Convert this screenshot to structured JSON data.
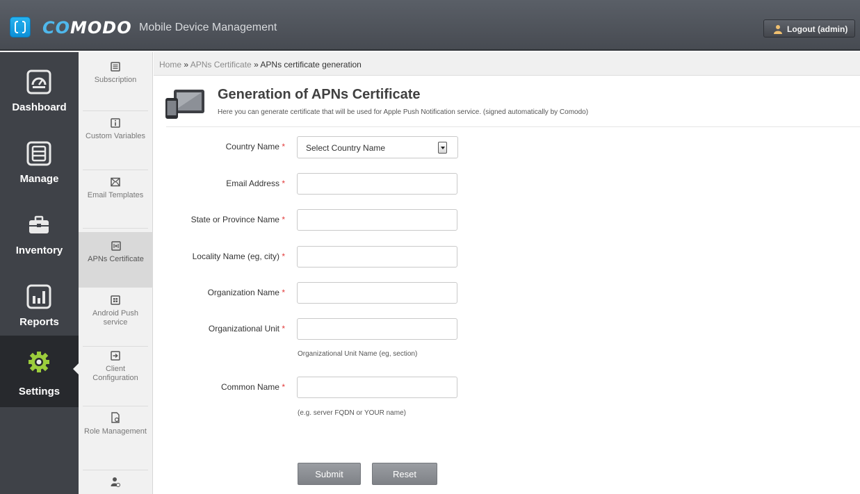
{
  "header": {
    "brand_prefix": "CO",
    "brand_rest": "MODO",
    "subtitle": "Mobile Device Management",
    "logout_label": "Logout (admin)"
  },
  "mainnav": {
    "items": [
      {
        "label": "Dashboard",
        "icon": "dashboard-icon"
      },
      {
        "label": "Manage",
        "icon": "manage-icon"
      },
      {
        "label": "Inventory",
        "icon": "inventory-icon"
      },
      {
        "label": "Reports",
        "icon": "reports-icon"
      },
      {
        "label": "Settings",
        "icon": "settings-gear-icon",
        "active": true
      }
    ]
  },
  "subnav": {
    "items": [
      {
        "label": "Subscription",
        "icon": "subscription-icon"
      },
      {
        "label": "Custom Variables",
        "icon": "info-icon"
      },
      {
        "label": "Email Templates",
        "icon": "envelope-icon"
      },
      {
        "label": "APNs Certificate",
        "icon": "certificate-icon",
        "active": true
      },
      {
        "label": "Android Push service",
        "icon": "push-icon"
      },
      {
        "label": "Client Configuration",
        "icon": "client-config-icon"
      },
      {
        "label": "Role Management",
        "icon": "role-icon"
      },
      {
        "label": "",
        "icon": "user-settings-icon"
      }
    ]
  },
  "breadcrumb": {
    "home": "Home",
    "sep": " » ",
    "parent": "APNs Certificate",
    "current": "APNs certificate generation"
  },
  "page": {
    "title": "Generation of APNs Certificate",
    "subtitle": "Here you can generate certificate that will be used for Apple Push Notification service. (signed automatically by Comodo)"
  },
  "form": {
    "required_mark": "*",
    "country": {
      "label": "Country Name",
      "value": "Select Country Name"
    },
    "email": {
      "label": "Email Address",
      "value": ""
    },
    "state": {
      "label": "State or Province Name",
      "value": ""
    },
    "locality": {
      "label": "Locality Name (eg, city)",
      "value": ""
    },
    "organization": {
      "label": "Organization Name",
      "value": ""
    },
    "org_unit": {
      "label": "Organizational Unit",
      "value": "",
      "hint": "Organizational Unit Name (eg, section)"
    },
    "common_name": {
      "label": "Common Name",
      "value": "",
      "hint": "(e.g. server FQDN or YOUR name)"
    },
    "submit_label": "Submit",
    "reset_label": "Reset"
  },
  "colors": {
    "accent": "#1aa3e8",
    "required": "#e23b3b",
    "header_bg": "#4f535a",
    "nav_bg": "#3f4248"
  }
}
